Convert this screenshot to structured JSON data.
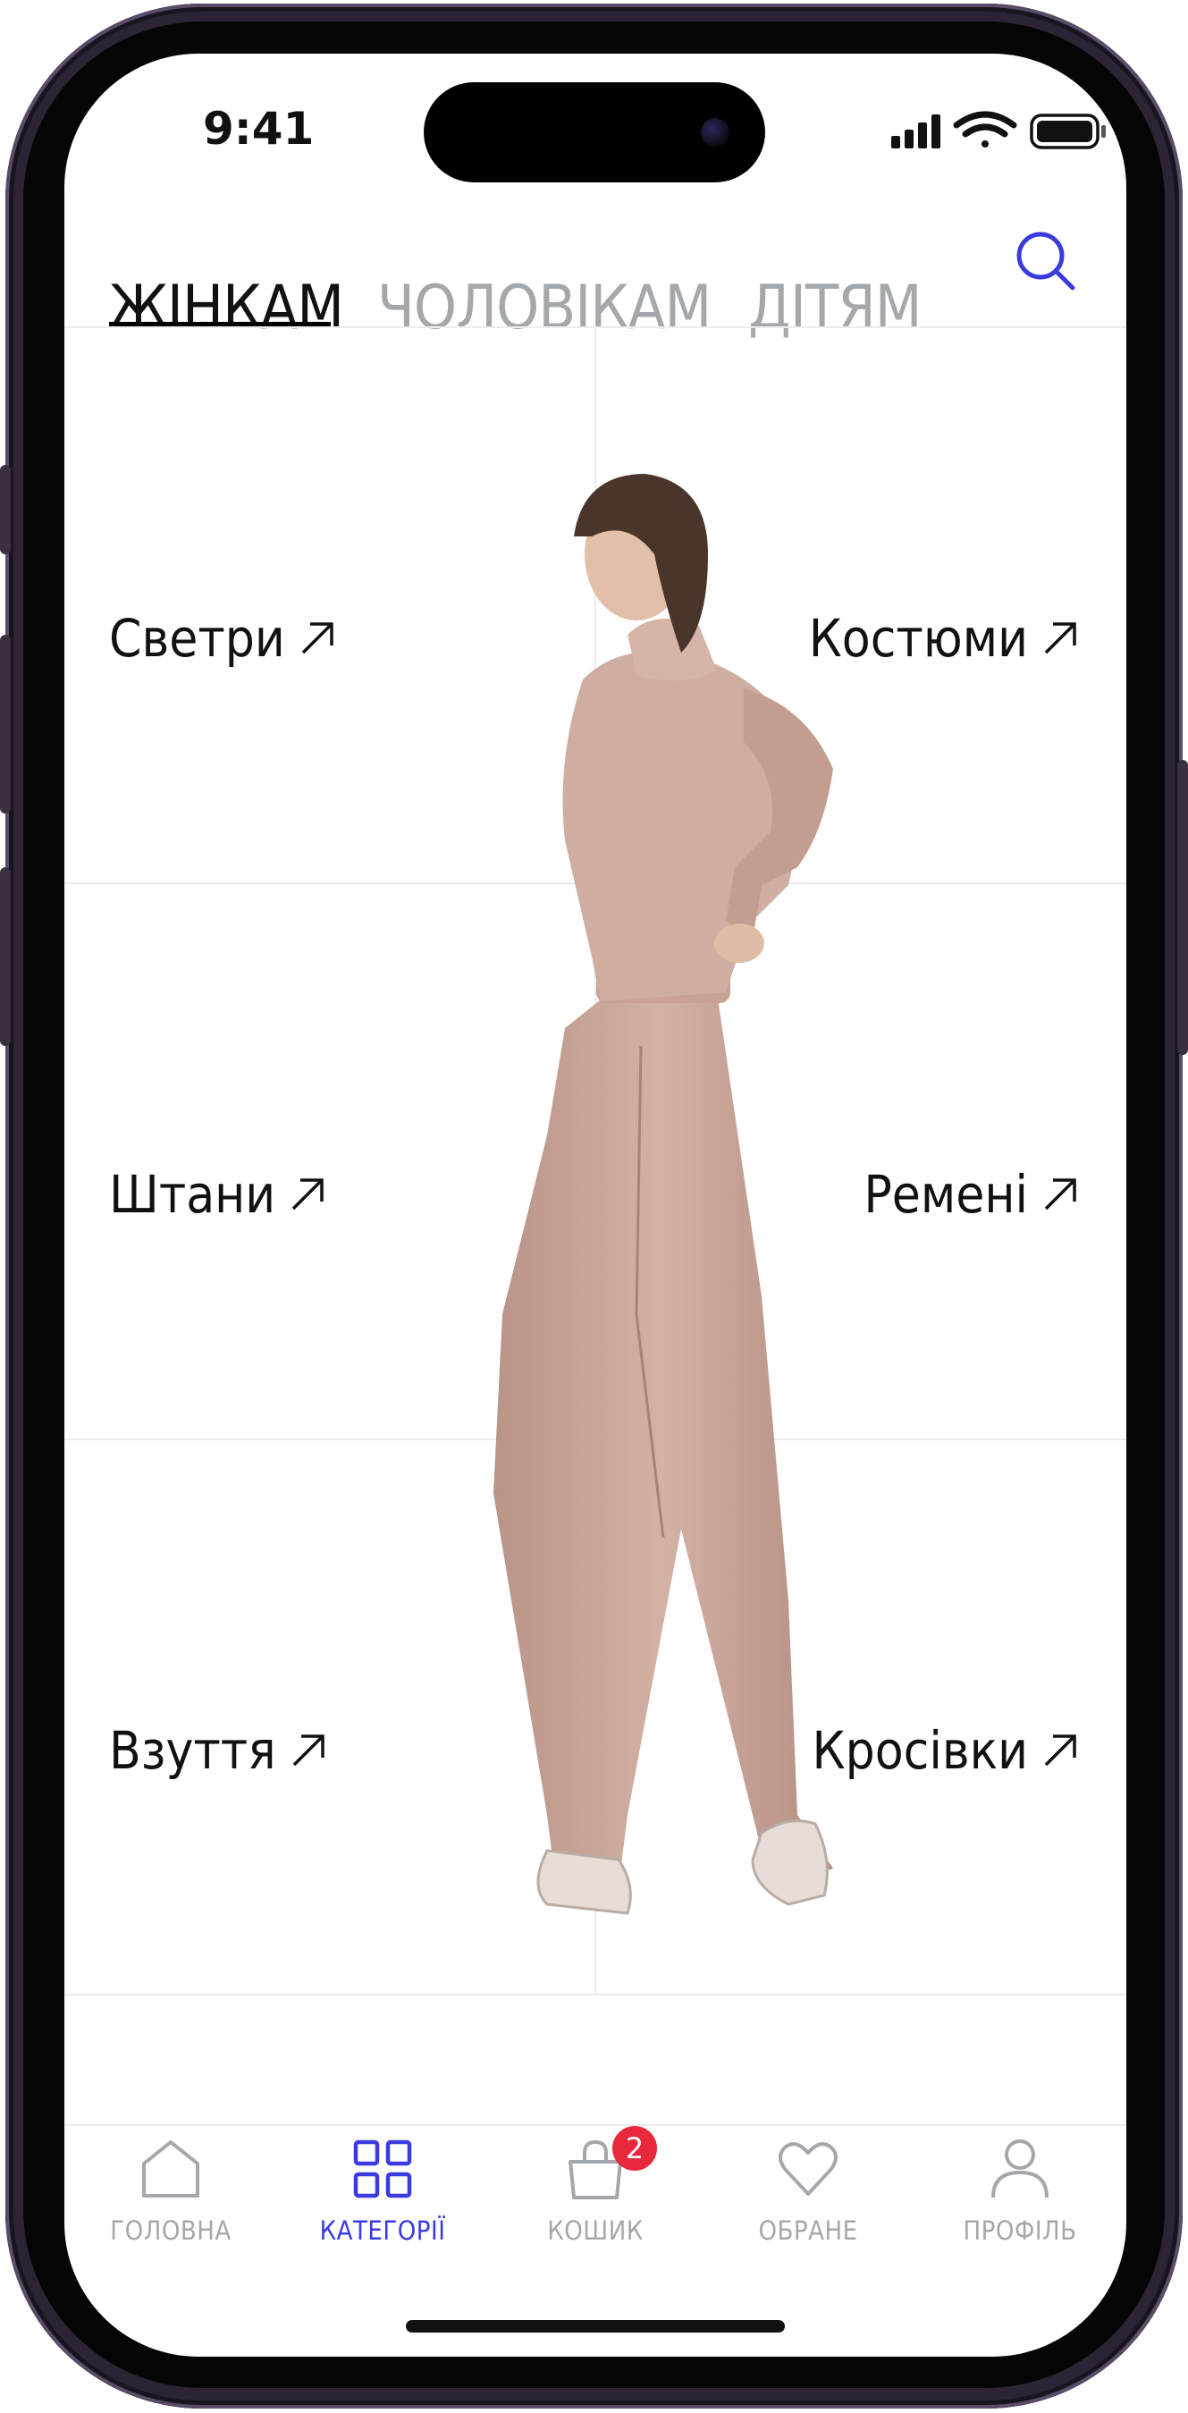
{
  "status_bar": {
    "time": "9:41"
  },
  "tabs": [
    {
      "label": "ЖІНКАМ",
      "active": true
    },
    {
      "label": "ЧОЛОВІКАМ",
      "active": false
    },
    {
      "label": "ДІТЯМ",
      "active": false
    }
  ],
  "search": {
    "icon": "search-icon"
  },
  "categories": [
    {
      "label": "Светри"
    },
    {
      "label": "Костюми"
    },
    {
      "label": "Штани"
    },
    {
      "label": "Ремені"
    },
    {
      "label": "Взуття"
    },
    {
      "label": "Кросівки"
    }
  ],
  "bottom_nav": [
    {
      "label": "ГОЛОВНА",
      "icon": "home-icon",
      "active": false
    },
    {
      "label": "КАТЕГОРІЇ",
      "icon": "grid-icon",
      "active": true
    },
    {
      "label": "КОШИК",
      "icon": "bag-icon",
      "active": false,
      "badge": "2"
    },
    {
      "label": "ОБРАНЕ",
      "icon": "heart-icon",
      "active": false
    },
    {
      "label": "ПРОФІЛЬ",
      "icon": "profile-icon",
      "active": false
    }
  ],
  "colors": {
    "accent": "#3a3adf",
    "badge": "#e8283c",
    "inactive_text": "#a5a8aa",
    "garment": "#c9a79a"
  }
}
